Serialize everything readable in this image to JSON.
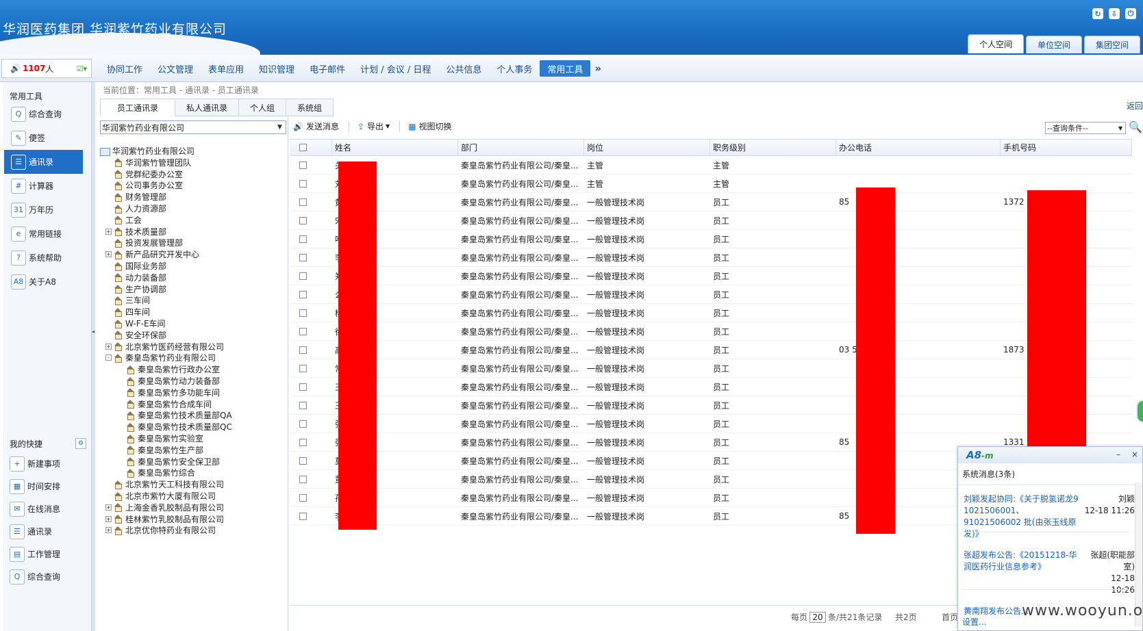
{
  "header": {
    "title": "华润医药集团  华润紫竹药业有限公司",
    "icons": [
      "refresh-icon",
      "download-icon",
      "logout-icon"
    ],
    "spaces": [
      "个人空间",
      "单位空间",
      "集团空间"
    ]
  },
  "online": {
    "count": "1107",
    "unit": "人"
  },
  "menu": [
    "协同工作",
    "公文管理",
    "表单应用",
    "知识管理",
    "电子邮件",
    "计划 / 会议 / 日程",
    "公共信息",
    "个人事务",
    "常用工具"
  ],
  "menu_more": "»",
  "sidebar": {
    "title": "常用工具",
    "items": [
      {
        "label": "综合查询",
        "icon": "Q"
      },
      {
        "label": "便签",
        "icon": "✎"
      },
      {
        "label": "通讯录",
        "icon": "☰"
      },
      {
        "label": "计算器",
        "icon": "#"
      },
      {
        "label": "万年历",
        "icon": "31"
      },
      {
        "label": "常用链接",
        "icon": "e"
      },
      {
        "label": "系统帮助",
        "icon": "?"
      },
      {
        "label": "关于A8",
        "icon": "A8"
      }
    ]
  },
  "quick": {
    "title": "我的快捷",
    "items": [
      {
        "label": "新建事项",
        "icon": "+"
      },
      {
        "label": "时间安排",
        "icon": "▦"
      },
      {
        "label": "在线消息",
        "icon": "✉"
      },
      {
        "label": "通讯录",
        "icon": "☰"
      },
      {
        "label": "工作管理",
        "icon": "▤"
      },
      {
        "label": "综合查询",
        "icon": "Q"
      }
    ]
  },
  "breadcrumb": "当前位置：常用工具 - 通讯录 - 员工通讯录",
  "back": "返回",
  "tabs": [
    "员工通讯录",
    "私人通讯录",
    "个人组",
    "系统组"
  ],
  "org_select": "华润紫竹药业有限公司",
  "tree": [
    {
      "label": "华润紫竹药业有限公司",
      "level": 0,
      "root": true
    },
    {
      "label": "华润紫竹管理团队",
      "level": 1
    },
    {
      "label": "党群纪委办公室",
      "level": 1
    },
    {
      "label": "公司事务办公室",
      "level": 1
    },
    {
      "label": "财务管理部",
      "level": 1
    },
    {
      "label": "人力资源部",
      "level": 1
    },
    {
      "label": "工会",
      "level": 1
    },
    {
      "label": "技术质量部",
      "level": 1,
      "toggle": "+"
    },
    {
      "label": "投资发展管理部",
      "level": 1
    },
    {
      "label": "新产品研究开发中心",
      "level": 1,
      "toggle": "+"
    },
    {
      "label": "国际业务部",
      "level": 1
    },
    {
      "label": "动力装备部",
      "level": 1
    },
    {
      "label": "生产协调部",
      "level": 1
    },
    {
      "label": "三车间",
      "level": 1
    },
    {
      "label": "四车间",
      "level": 1
    },
    {
      "label": "W-F-E车间",
      "level": 1
    },
    {
      "label": "安全环保部",
      "level": 1
    },
    {
      "label": "北京紫竹医药经营有限公司",
      "level": 1,
      "toggle": "+"
    },
    {
      "label": "秦皇岛紫竹药业有限公司",
      "level": 1,
      "toggle": "-"
    },
    {
      "label": "秦皇岛紫竹行政办公室",
      "level": 2
    },
    {
      "label": "秦皇岛紫竹动力装备部",
      "level": 2
    },
    {
      "label": "秦皇岛紫竹多功能车间",
      "level": 2
    },
    {
      "label": "秦皇岛紫竹合成车间",
      "level": 2
    },
    {
      "label": "秦皇岛紫竹技术质量部QA",
      "level": 2
    },
    {
      "label": "秦皇岛紫竹技术质量部QC",
      "level": 2
    },
    {
      "label": "秦皇岛紫竹实验室",
      "level": 2
    },
    {
      "label": "秦皇岛紫竹生产部",
      "level": 2
    },
    {
      "label": "秦皇岛紫竹安全保卫部",
      "level": 2
    },
    {
      "label": "秦皇岛紫竹综合",
      "level": 2
    },
    {
      "label": "北京紫竹天工科技有限公司",
      "level": 1
    },
    {
      "label": "北京市紫竹大厦有限公司",
      "level": 1
    },
    {
      "label": "上海金香乳胶制品有限公司",
      "level": 1,
      "toggle": "+"
    },
    {
      "label": "桂林紫竹乳胶制品有限公司",
      "level": 1,
      "toggle": "+"
    },
    {
      "label": "北京优你特药业有限公司",
      "level": 1,
      "toggle": "+"
    }
  ],
  "toolbar": {
    "send": "发送消息",
    "export": "导出",
    "view": "视图切换"
  },
  "query_select": "--查询条件--",
  "table": {
    "headers": [
      "姓名",
      "部门",
      "岗位",
      "职务级别",
      "办公电话",
      "手机号码"
    ],
    "rows": [
      {
        "name": "关",
        "dept": "秦皇岛紫竹药业有限公司/秦皇...",
        "post": "主管",
        "level": "主管",
        "phone": "",
        "mobile": ""
      },
      {
        "name": "刘",
        "dept": "秦皇岛紫竹药业有限公司/秦皇...",
        "post": "主管",
        "level": "主管",
        "phone": "",
        "mobile": ""
      },
      {
        "name": "黄",
        "dept": "秦皇岛紫竹药业有限公司/秦皇...",
        "post": "一般管理技术岗",
        "level": "员工",
        "phone": "85",
        "mobile": "1372"
      },
      {
        "name": "宋",
        "dept": "秦皇岛紫竹药业有限公司/秦皇...",
        "post": "一般管理技术岗",
        "level": "员工",
        "phone": "",
        "mobile": ""
      },
      {
        "name": "叶",
        "dept": "秦皇岛紫竹药业有限公司/秦皇...",
        "post": "一般管理技术岗",
        "level": "员工",
        "phone": "",
        "mobile": ""
      },
      {
        "name": "李",
        "dept": "秦皇岛紫竹药业有限公司/秦皇...",
        "post": "一般管理技术岗",
        "level": "员工",
        "phone": "",
        "mobile": ""
      },
      {
        "name": "郑",
        "dept": "秦皇岛紫竹药业有限公司/秦皇...",
        "post": "一般管理技术岗",
        "level": "员工",
        "phone": "",
        "mobile": ""
      },
      {
        "name": "么",
        "dept": "秦皇岛紫竹药业有限公司/秦皇...",
        "post": "一般管理技术岗",
        "level": "员工",
        "phone": "",
        "mobile": ""
      },
      {
        "name": "杨",
        "dept": "秦皇岛紫竹药业有限公司/秦皇...",
        "post": "一般管理技术岗",
        "level": "员工",
        "phone": "",
        "mobile": ""
      },
      {
        "name": "徐",
        "dept": "秦皇岛紫竹药业有限公司/秦皇...",
        "post": "一般管理技术岗",
        "level": "员工",
        "phone": "",
        "mobile": ""
      },
      {
        "name": "高",
        "dept": "秦皇岛紫竹药业有限公司/秦皇...",
        "post": "一般管理技术岗",
        "level": "员工",
        "phone": "03        5",
        "mobile": "1873"
      },
      {
        "name": "常",
        "dept": "秦皇岛紫竹药业有限公司/秦皇...",
        "post": "一般管理技术岗",
        "level": "员工",
        "phone": "",
        "mobile": ""
      },
      {
        "name": "王",
        "dept": "秦皇岛紫竹药业有限公司/秦皇...",
        "post": "一般管理技术岗",
        "level": "员工",
        "phone": "",
        "mobile": ""
      },
      {
        "name": "王",
        "dept": "秦皇岛紫竹药业有限公司/秦皇...",
        "post": "一般管理技术岗",
        "level": "员工",
        "phone": "",
        "mobile": ""
      },
      {
        "name": "张",
        "dept": "秦皇岛紫竹药业有限公司/秦皇...",
        "post": "一般管理技术岗",
        "level": "员工",
        "phone": "",
        "mobile": ""
      },
      {
        "name": "张",
        "dept": "秦皇岛紫竹药业有限公司/秦皇...",
        "post": "一般管理技术岗",
        "level": "员工",
        "phone": "85",
        "mobile": "1331"
      },
      {
        "name": "莫",
        "dept": "秦皇岛紫竹药业有限公司/秦皇...",
        "post": "一般管理技术岗",
        "level": "员工",
        "phone": "",
        "mobile": ""
      },
      {
        "name": "董",
        "dept": "秦皇岛紫竹药业有限公司/秦皇...",
        "post": "一般管理技术岗",
        "level": "员工",
        "phone": "",
        "mobile": ""
      },
      {
        "name": "孙",
        "dept": "秦皇岛紫竹药业有限公司/秦皇...",
        "post": "一般管理技术岗",
        "level": "员工",
        "phone": "",
        "mobile": ""
      },
      {
        "name": "李",
        "dept": "秦皇岛紫竹药业有限公司/秦皇...",
        "post": "一般管理技术岗",
        "level": "员工",
        "phone": "85",
        "mobile": ""
      }
    ]
  },
  "pager": {
    "per_page_pre": "每页",
    "per_page": "20",
    "per_page_post": "条/共21条记录",
    "total_pages": "共2页",
    "first": "首页"
  },
  "popup": {
    "logo": "A8",
    "logo_m": "-m",
    "minimize": "–",
    "close": "×",
    "status": "系统消息(3条)",
    "messages": [
      {
        "text": "刘颖发起协同:《关于脱氢诺龙9 1021506001、91021506002 批(由张玉线原发)》",
        "from": "刘颖",
        "time": "12-18 11:26"
      },
      {
        "text": "张超发布公告:《20151218-华润医药行业信息参考》",
        "from": "张超(职能部室)",
        "time": "12-18 10:26"
      },
      {
        "text": "黄南翔发布公告...",
        "from": "",
        "time": ""
      }
    ],
    "settings": "设置..."
  },
  "watermark": "www.wooyun.org"
}
